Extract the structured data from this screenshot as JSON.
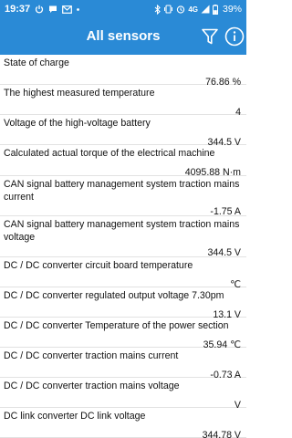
{
  "status_bar": {
    "time": "19:37",
    "network": "4G",
    "battery": "39%",
    "icons": [
      "power-icon",
      "message-icon",
      "mail-icon",
      "more-dots-icon",
      "bluetooth-icon",
      "vibrate-icon",
      "alarm-icon",
      "signal-icon",
      "battery-icon"
    ]
  },
  "app_bar": {
    "title": "All sensors",
    "icons": [
      "filter-icon",
      "info-icon"
    ]
  },
  "sensors": [
    {
      "label": "State of charge",
      "value": "76.86 %"
    },
    {
      "label": "The highest measured temperature",
      "value": "4"
    },
    {
      "label": "Voltage of the high-voltage battery",
      "value": "344.5 V"
    },
    {
      "label": "Calculated actual torque of the electrical machine",
      "value": "4095.88 N·m"
    },
    {
      "label": "CAN signal battery management system traction mains current",
      "value": "-1.75 A"
    },
    {
      "label": "CAN signal battery management system traction mains voltage",
      "value": "344.5 V"
    },
    {
      "label": "DC / DC converter circuit board temperature",
      "value": "℃"
    },
    {
      "label": "DC / DC converter regulated output voltage 7.30pm",
      "value": "13.1 V"
    },
    {
      "label": "DC / DC converter Temperature of the power section",
      "value": "35.94 ℃"
    },
    {
      "label": "DC / DC converter traction mains current",
      "value": "-0.73 A"
    },
    {
      "label": "DC / DC converter traction mains voltage",
      "value": "V"
    },
    {
      "label": "DC link converter DC link voltage",
      "value": "344.78 V"
    }
  ],
  "colors": {
    "primary": "#2a8ad6",
    "divider": "#e2e2e2",
    "text": "#111111"
  }
}
